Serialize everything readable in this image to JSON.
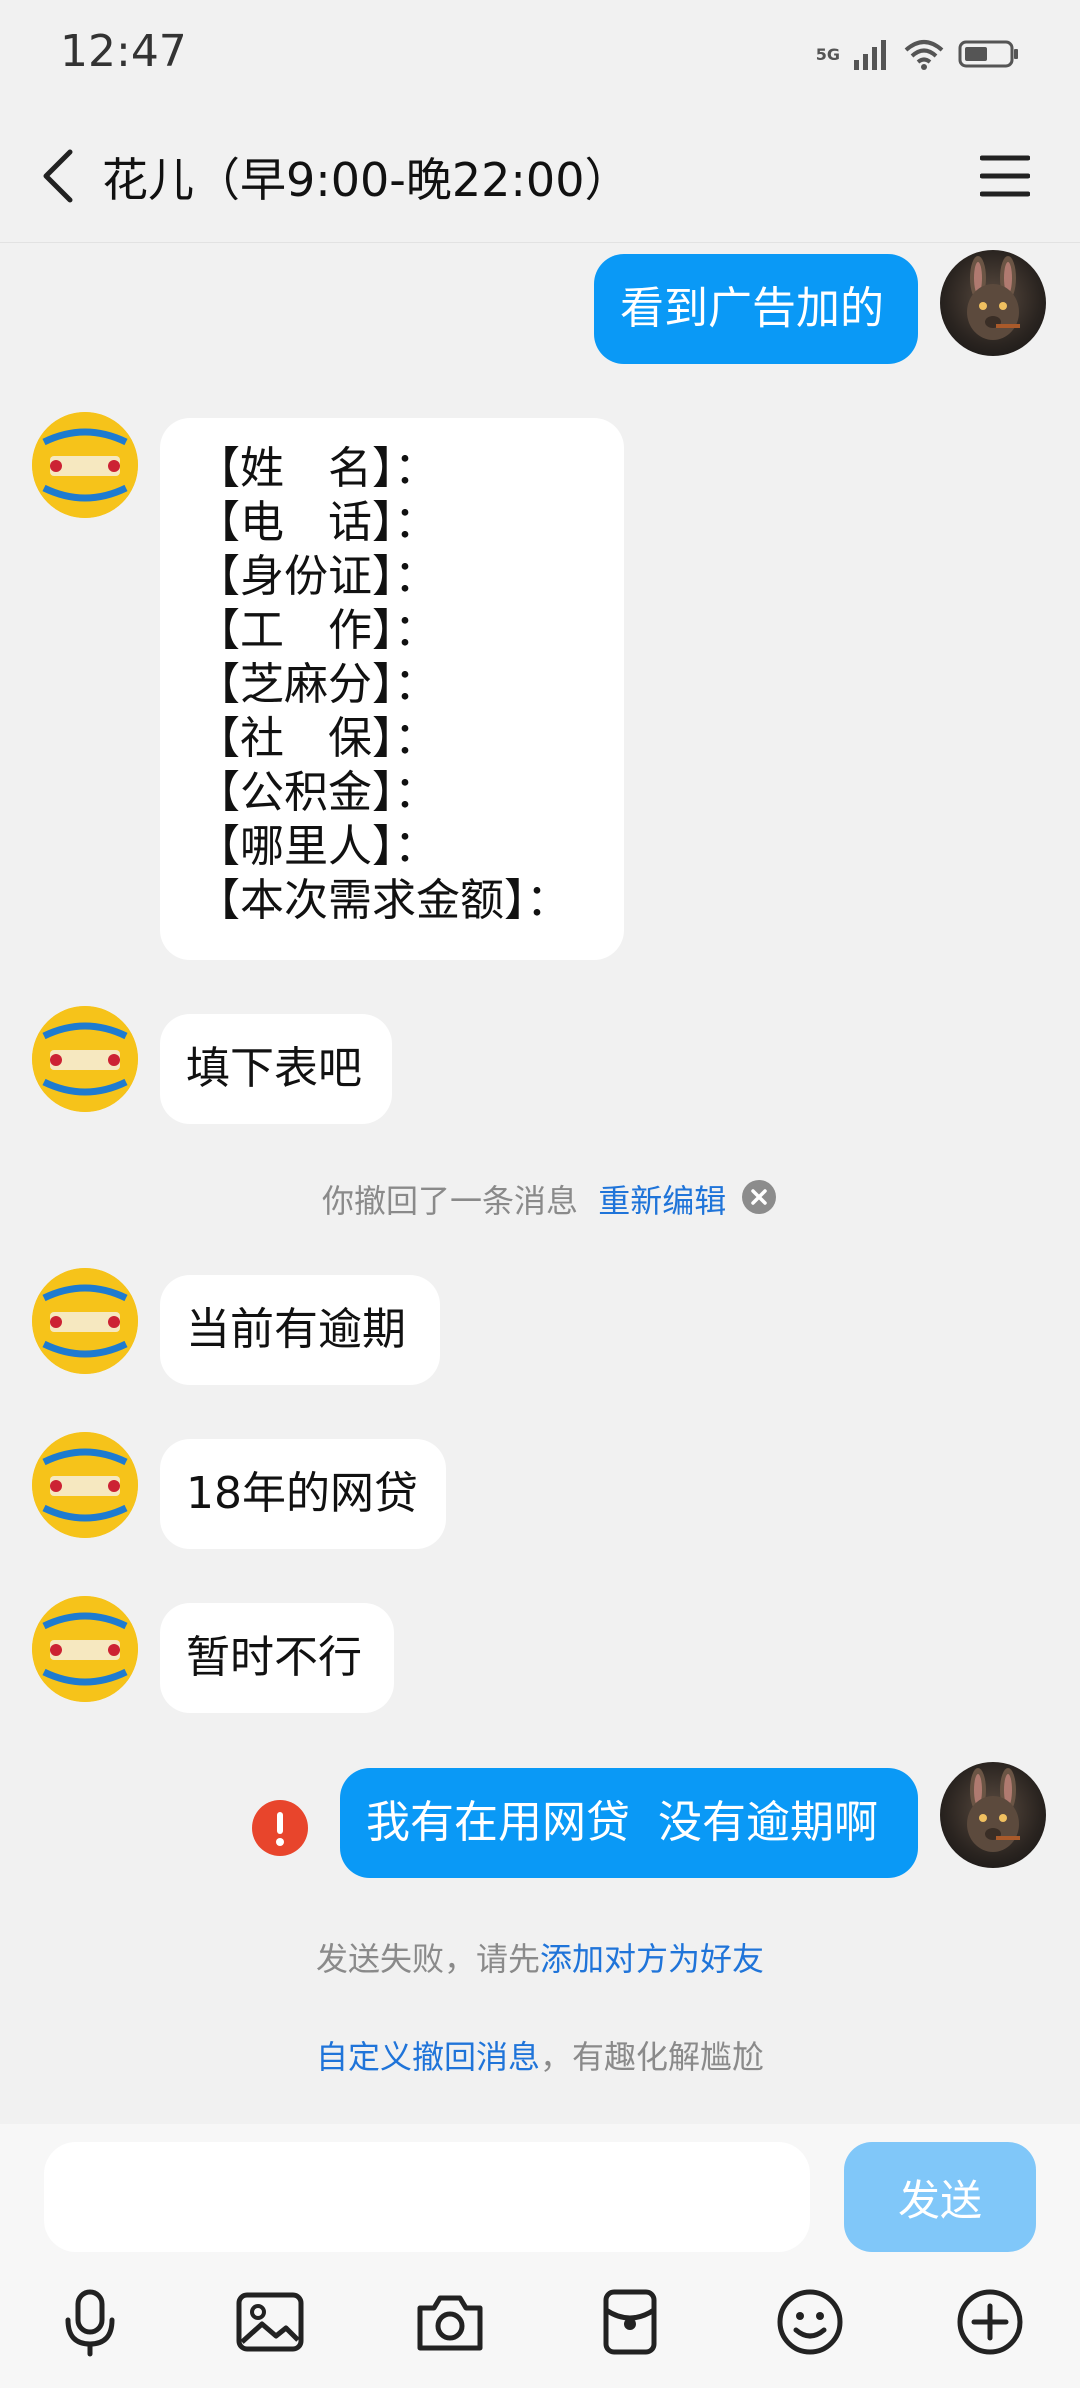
{
  "status_bar": {
    "time": "12:47",
    "network": "5G",
    "icons": [
      "signal-icon",
      "wifi-icon",
      "battery-icon"
    ]
  },
  "header": {
    "title": "花儿（早9:00-晚22:00）",
    "icons": [
      "back-icon",
      "menu-icon"
    ]
  },
  "messages": {
    "m1": "看到广告加的",
    "form": [
      "【姓　名】：",
      "【电　话】：",
      "【身份证】：",
      "【工　作】：",
      "【芝麻分】：",
      "【社　保】：",
      "【公积金】：",
      "【哪里人】：",
      "【本次需求金额】："
    ],
    "m3": "填下表吧",
    "recall": {
      "text": "你撤回了一条消息",
      "link": "重新编辑"
    },
    "m4": "当前有逾期",
    "m5": "18年的网贷",
    "m6": "暂时不行",
    "m7": "我有在用网贷  没有逾期啊",
    "send_failed": {
      "text": "发送失败，请先",
      "link": "添加对方为好友"
    },
    "custom_recall": {
      "link": "自定义撤回消息",
      "text": "，有趣化解尴尬"
    }
  },
  "composer": {
    "input_value": "",
    "send_label": "发送",
    "tools": [
      "microphone-icon",
      "image-icon",
      "camera-icon",
      "red-packet-icon",
      "emoji-icon",
      "plus-icon"
    ]
  },
  "colors": {
    "background": "#f1f1f1",
    "outgoing_bubble": "#0a99f6",
    "incoming_bubble": "#ffffff",
    "link": "#1f74d9",
    "error": "#e8452c",
    "send_button": "#80c7f9"
  }
}
